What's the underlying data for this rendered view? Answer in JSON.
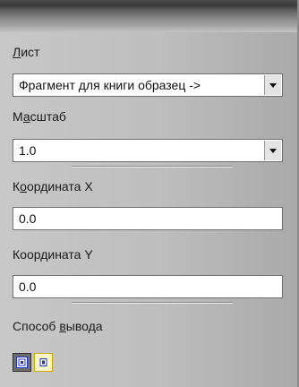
{
  "sheet": {
    "label_accel": "Л",
    "label_rest": "ист",
    "value": "Фрагмент для книги образец ->"
  },
  "scale": {
    "label_pre": "М",
    "label_accel": "а",
    "label_rest": "сштаб",
    "value": "1.0"
  },
  "coord_x": {
    "label_pre": "К",
    "label_accel": "о",
    "label_rest": "ордината X",
    "value": "0.0"
  },
  "coord_y": {
    "label_pre": "Коор",
    "label_accel": "д",
    "label_rest": "ината Y",
    "value": "0.0"
  },
  "output": {
    "label_pre": "Способ ",
    "label_accel": "в",
    "label_rest": "ывода",
    "modes": [
      {
        "icon": "output-mode-1-icon",
        "state": "pressed"
      },
      {
        "icon": "output-mode-2-icon",
        "state": "highlighted"
      }
    ]
  },
  "colors": {
    "panel": "#bdbdbd",
    "active_button": "#6e6e6e",
    "hover_button": "#fff6c8",
    "icon_blue": "#1e32c8"
  }
}
